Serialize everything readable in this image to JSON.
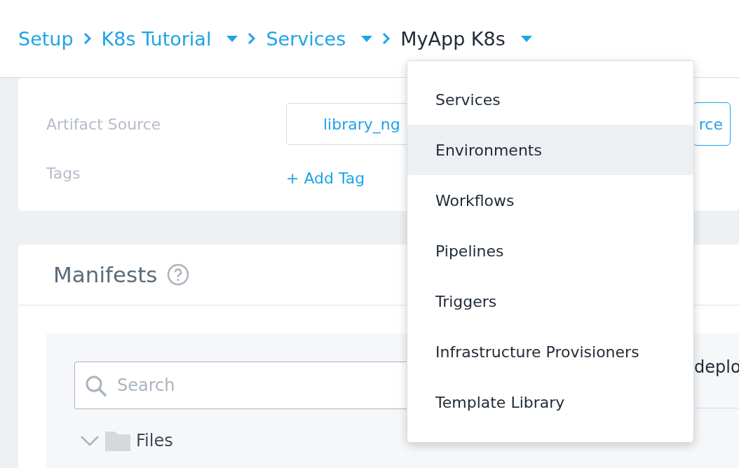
{
  "breadcrumbs": [
    {
      "label": "Setup",
      "current": false,
      "has_menu": false
    },
    {
      "label": "K8s Tutorial",
      "current": false,
      "has_menu": true
    },
    {
      "label": "Services",
      "current": false,
      "has_menu": true
    },
    {
      "label": "MyApp K8s",
      "current": true,
      "has_menu": true
    }
  ],
  "artifact": {
    "rows": [
      {
        "label": "Artifact Source",
        "kind": "source",
        "value": "library_ng",
        "button": "rce"
      },
      {
        "label": "Tags",
        "kind": "link",
        "value": "+ Add Tag"
      }
    ]
  },
  "manifests": {
    "title": "Manifests",
    "search": {
      "placeholder": "Search"
    },
    "tree": [
      {
        "label": "Files",
        "expanded": true
      }
    ],
    "editor": {
      "title": "deplo"
    }
  },
  "menu": {
    "items": [
      {
        "label": "Services",
        "selected": false
      },
      {
        "label": "Environments",
        "selected": true
      },
      {
        "label": "Workflows",
        "selected": false
      },
      {
        "label": "Pipelines",
        "selected": false
      },
      {
        "label": "Triggers",
        "selected": false
      },
      {
        "label": "Infrastructure Provisioners",
        "selected": false
      },
      {
        "label": "Template Library",
        "selected": false
      }
    ]
  }
}
